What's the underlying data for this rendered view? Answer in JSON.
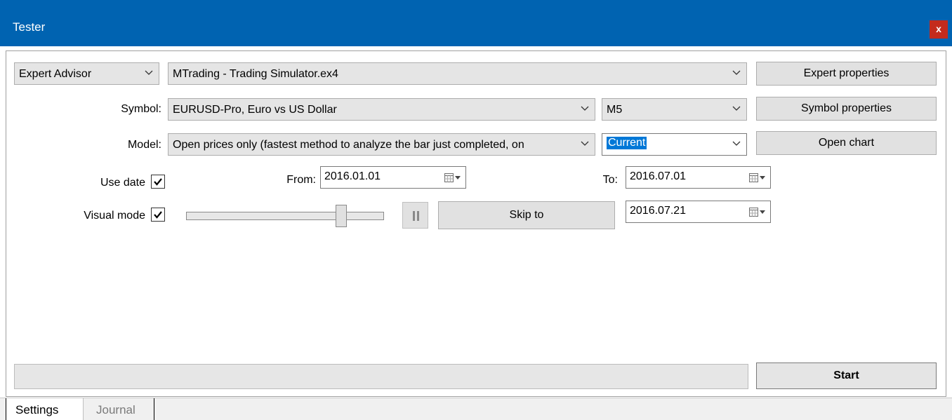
{
  "window": {
    "title": "Tester",
    "close_label": "x"
  },
  "row1": {
    "mode": "Expert Advisor",
    "expert": "MTrading - Trading Simulator.ex4",
    "expert_properties": "Expert properties"
  },
  "row2": {
    "symbol_label": "Symbol:",
    "symbol": "EURUSD-Pro, Euro vs US Dollar",
    "period": "M5",
    "symbol_properties": "Symbol properties"
  },
  "row3": {
    "model_label": "Model:",
    "model": "Open prices only (fastest method to analyze the bar just completed, on",
    "spread": "Current",
    "open_chart": "Open chart"
  },
  "row4": {
    "use_date_label": "Use date",
    "use_date_checked": true,
    "from_label": "From:",
    "from_date": "2016.01.01",
    "to_label": "To:",
    "to_date": "2016.07.01"
  },
  "row5": {
    "visual_mode_label": "Visual mode",
    "visual_mode_checked": true,
    "speed_fraction": 0.8,
    "skip_to": "Skip to",
    "skip_date": "2016.07.21"
  },
  "bottom": {
    "start": "Start"
  },
  "tabs": [
    {
      "label": "Settings",
      "active": true
    },
    {
      "label": "Journal",
      "active": false
    }
  ],
  "icons": {
    "dropdown": "chevron-down-icon",
    "calendar": "calendar-dropdown-icon",
    "pause": "pause-icon",
    "check": "checkmark-icon"
  },
  "colors": {
    "titlebar": "#0063b1",
    "close": "#c42b1c",
    "selection": "#0078d7"
  }
}
